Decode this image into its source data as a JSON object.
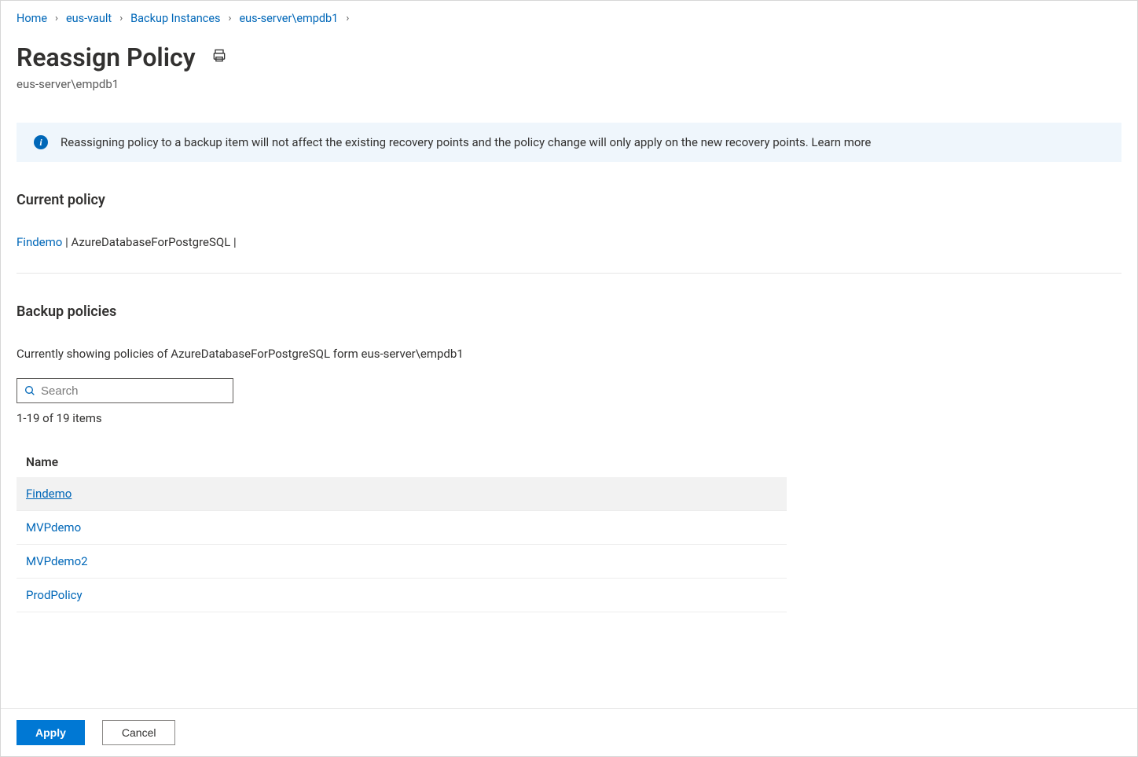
{
  "breadcrumb": {
    "items": [
      {
        "label": "Home"
      },
      {
        "label": "eus-vault"
      },
      {
        "label": "Backup Instances"
      },
      {
        "label": "eus-server\\empdb1"
      }
    ]
  },
  "page": {
    "title": "Reassign Policy",
    "subtitle": "eus-server\\empdb1"
  },
  "infobar": {
    "text": "Reassigning policy to a backup item will not affect the existing recovery points and the policy change will only apply on the new recovery points. Learn more"
  },
  "current_policy": {
    "heading": "Current policy",
    "name": "Findemo",
    "separator1": "  |  ",
    "type": "AzureDatabaseForPostgreSQL",
    "separator2": "  |"
  },
  "backup_policies": {
    "heading": "Backup policies",
    "description": "Currently showing policies of AzureDatabaseForPostgreSQL form eus-server\\empdb1",
    "search_placeholder": "Search",
    "count_text": "1-19 of 19 items",
    "column_header": "Name",
    "rows": [
      {
        "name": "Findemo",
        "selected": true
      },
      {
        "name": "MVPdemo",
        "selected": false
      },
      {
        "name": "MVPdemo2",
        "selected": false
      },
      {
        "name": "ProdPolicy",
        "selected": false
      }
    ]
  },
  "actions": {
    "apply_label": "Apply",
    "cancel_label": "Cancel"
  }
}
